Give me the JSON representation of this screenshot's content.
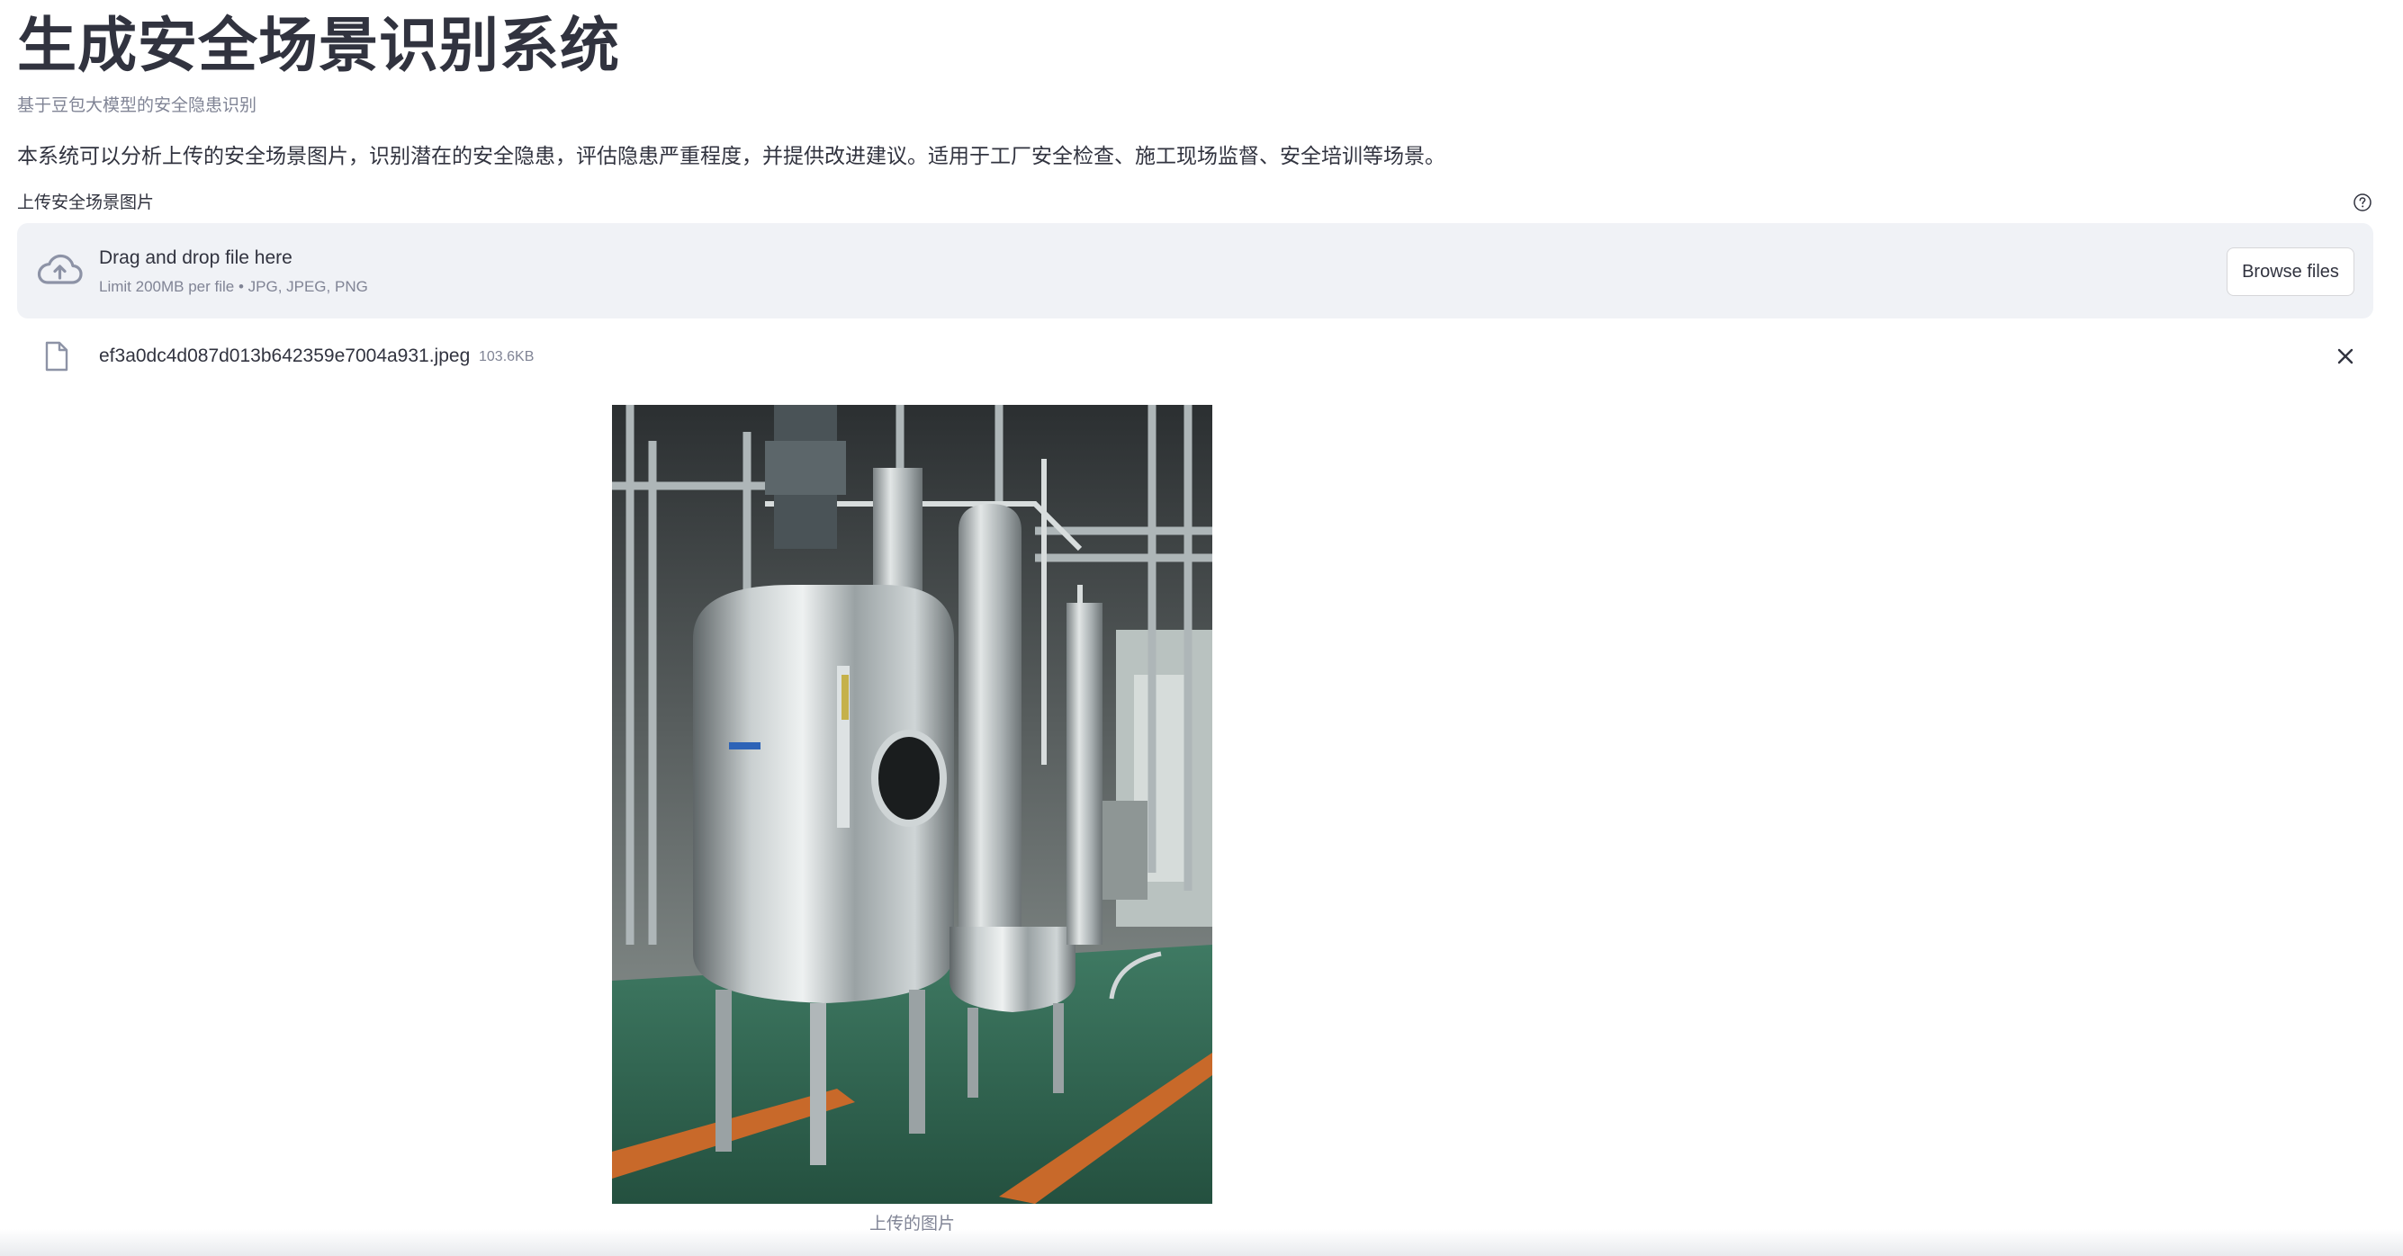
{
  "page": {
    "title": "生成安全场景识别系统",
    "subtitle": "基于豆包大模型的安全隐患识别",
    "description": "本系统可以分析上传的安全场景图片，识别潜在的安全隐患，评估隐患严重程度，并提供改进建议。适用于工厂安全检查、施工现场监督、安全培训等场景。"
  },
  "uploader": {
    "label": "上传安全场景图片",
    "help_icon": "question-circle-icon",
    "dropzone_icon": "cloud-upload-icon",
    "drag_text": "Drag and drop file here",
    "limit_text": "Limit 200MB per file • JPG, JPEG, PNG",
    "browse_label": "Browse files"
  },
  "uploaded_file": {
    "icon": "file-icon",
    "name": "ef3a0dc4d087d013b642359e7004a931.jpeg",
    "size": "103.6KB",
    "remove_icon": "close-icon"
  },
  "image": {
    "caption": "上传的图片"
  },
  "colors": {
    "text": "#31333f",
    "muted": "#808495",
    "dropzone_bg": "#f0f2f6",
    "floor_green": "#2f6a55",
    "floor_stripe": "#d9752f"
  }
}
